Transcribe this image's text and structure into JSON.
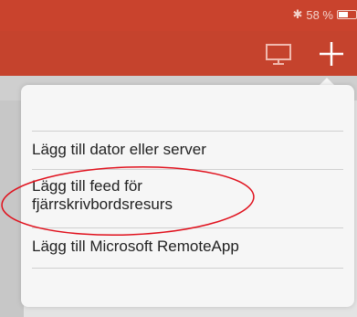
{
  "status": {
    "battery_text": "58 %",
    "battery_level": 0.58,
    "bluetooth_glyph": "✱"
  },
  "toolbar": {
    "monitor_icon": "monitor-icon",
    "add_icon": "plus-icon"
  },
  "menu": {
    "items": [
      {
        "label": "Lägg till dator eller server"
      },
      {
        "label_line1": "Lägg till feed för",
        "label_line2": "fjärrskrivbordsresurs"
      },
      {
        "label": "Lägg till Microsoft RemoteApp"
      }
    ]
  },
  "colors": {
    "accent": "#c5432d",
    "highlight": "#e0101c",
    "popover_bg": "#f6f6f6"
  }
}
